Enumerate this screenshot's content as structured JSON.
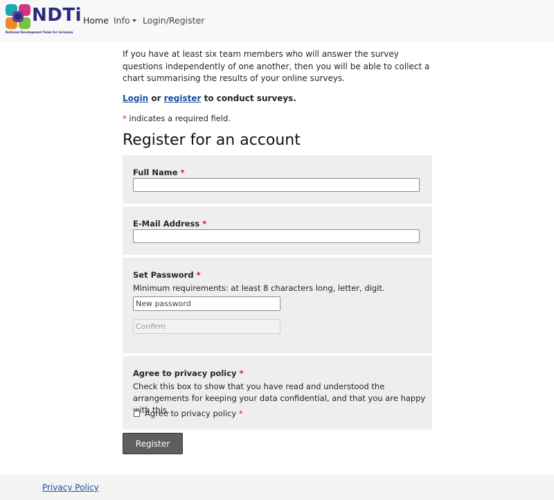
{
  "brand": {
    "name": "NDTi",
    "tagline": "National Development Team for Inclusion",
    "colors": {
      "navy": "#2b2a7a",
      "teal": "#1aa9b0",
      "magenta": "#d6337a",
      "orange": "#f08a24",
      "green": "#7bc043",
      "purple": "#6d3f99"
    }
  },
  "nav": {
    "home": "Home",
    "info": "Info",
    "login_register": "Login/Register"
  },
  "intro": {
    "paragraph": "If you have at least six team members who will answer the survey questions independently of one another, then you will be able to collect a chart summarising the results of your online surveys.",
    "login_link": "Login",
    "or_text": "or",
    "register_link": "register",
    "suffix": "to conduct surveys.",
    "required_asterisk": "*",
    "required_note": "indicates a required field."
  },
  "form": {
    "title": "Register for an account",
    "full_name": {
      "label": "Full Name",
      "value": ""
    },
    "email": {
      "label": "E-Mail Address",
      "value": ""
    },
    "password": {
      "label": "Set Password",
      "help": "Minimum requirements: at least 8 characters long, letter, digit.",
      "new_placeholder": "New password",
      "confirm_placeholder": "Confirm"
    },
    "privacy": {
      "label": "Agree to privacy policy",
      "help": "Check this box to show that you have read and understood the arrangements for keeping your data confidential, and that you are happy with this.",
      "checkbox_label": "Agree to privacy policy",
      "checked": false
    },
    "asterisk": "*",
    "submit": "Register"
  },
  "footer": {
    "privacy_policy": "Privacy Policy"
  },
  "colors": {
    "link": "#1a4fa0",
    "required": "#d11a1a",
    "fieldset_bg": "#eeeeee",
    "button_bg": "#5e5e5e"
  }
}
